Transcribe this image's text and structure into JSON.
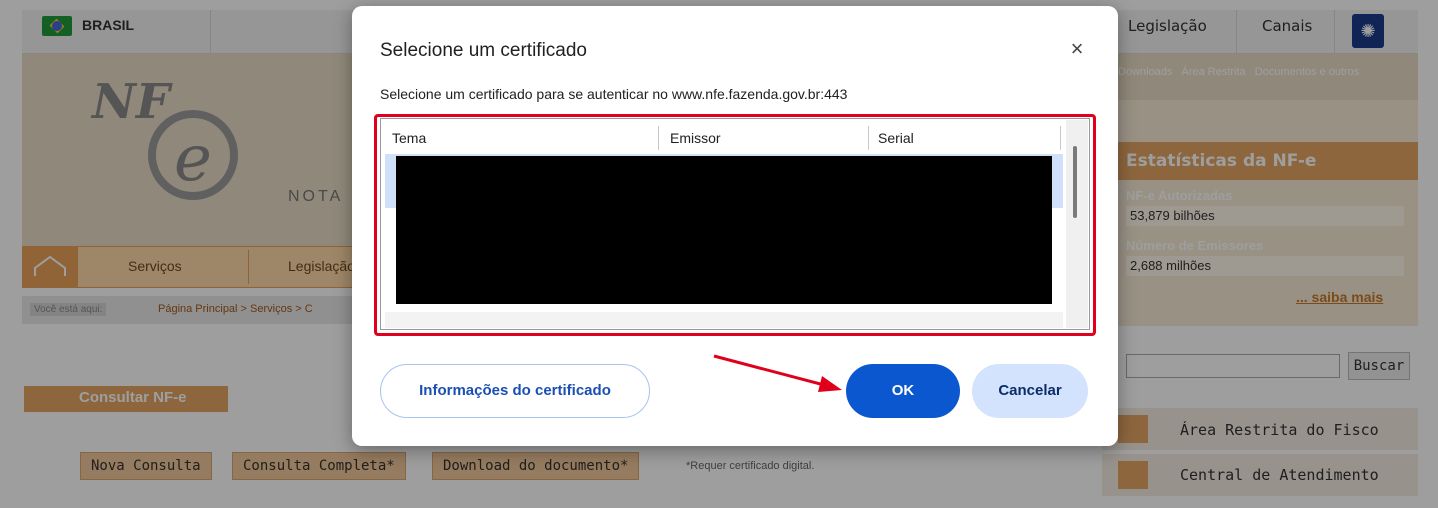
{
  "site": {
    "country": "BRASIL",
    "top_links": [
      "Legislação",
      "Canais"
    ],
    "logo_nf": "NF",
    "logo_e": "e",
    "logo_nota": "NOTA",
    "secondary_links": [
      "Downloads",
      "Área Restrita",
      "Documentos e outros"
    ],
    "nav_items": [
      "Serviços",
      "Legislação"
    ],
    "breadcrumb_prefix": "Você está aqui:",
    "breadcrumb_path": "Página Principal > Serviços > C",
    "section_title": "Consultar NF-e",
    "action_buttons": [
      "Nova Consulta",
      "Consulta Completa*",
      "Download do documento*"
    ],
    "requires_note": "*Requer certificado digital."
  },
  "stats": {
    "title": "Estatísticas da NF-e",
    "authorized_label": "NF-e Autorizadas",
    "authorized_value": "53,879 bilhões",
    "issuers_label": "Número de Emissores",
    "issuers_value": "2,688 milhões",
    "more_link": "... saiba mais"
  },
  "search": {
    "button_label": "Buscar",
    "value": ""
  },
  "side_menu": [
    "Área Restrita do Fisco",
    "Central de Atendimento"
  ],
  "dialog": {
    "title": "Selecione um certificado",
    "subtitle": "Selecione um certificado para se autenticar no www.nfe.fazenda.gov.br:443",
    "close_glyph": "×",
    "columns": [
      "Tema",
      "Emissor",
      "Serial"
    ],
    "info_button": "Informações do certificado",
    "ok_button": "OK",
    "cancel_button": "Cancelar"
  },
  "colors": {
    "primary": "#0b57d0",
    "highlight_box": "#e0001b",
    "site_orange": "#e4a565"
  }
}
